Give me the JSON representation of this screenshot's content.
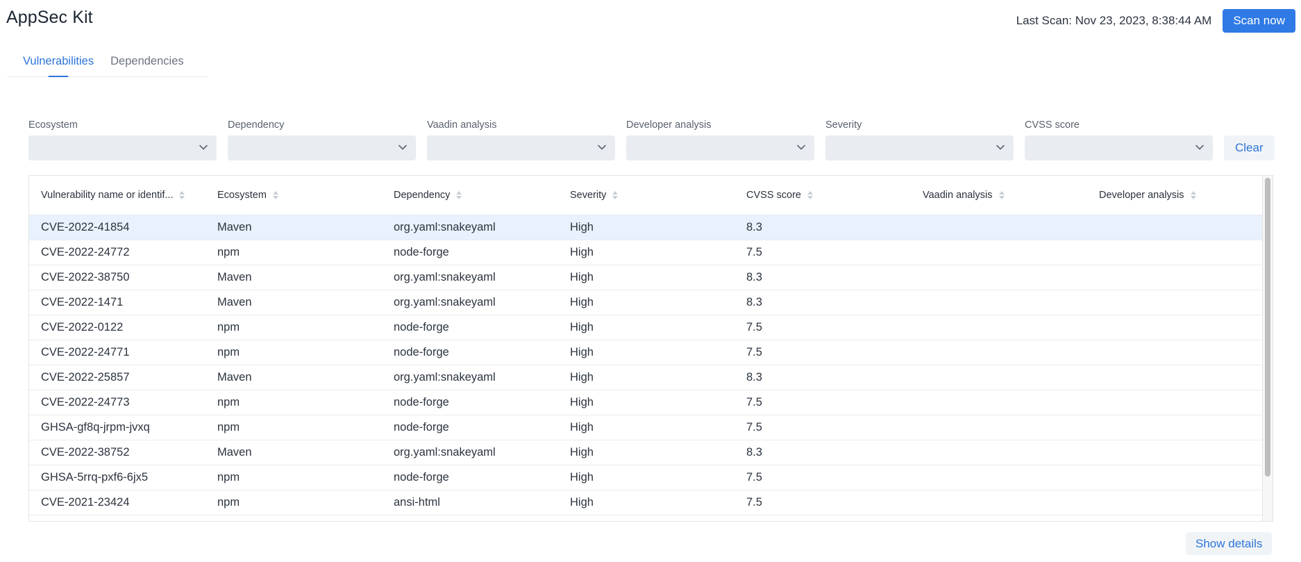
{
  "app": {
    "title": "AppSec Kit"
  },
  "header": {
    "last_scan": "Last Scan: Nov 23, 2023, 8:38:44 AM",
    "scan_now_label": "Scan now",
    "accent_color": "#2f7ae5"
  },
  "tabs": [
    {
      "label": "Vulnerabilities",
      "active": true
    },
    {
      "label": "Dependencies",
      "active": false
    }
  ],
  "filters": [
    {
      "label": "Ecosystem",
      "value": ""
    },
    {
      "label": "Dependency",
      "value": ""
    },
    {
      "label": "Vaadin analysis",
      "value": ""
    },
    {
      "label": "Developer analysis",
      "value": ""
    },
    {
      "label": "Severity",
      "value": ""
    },
    {
      "label": "CVSS score",
      "value": ""
    }
  ],
  "clear_label": "Clear",
  "grid": {
    "columns": [
      "Vulnerability name or identif...",
      "Ecosystem",
      "Dependency",
      "Severity",
      "CVSS score",
      "Vaadin analysis",
      "Developer analysis"
    ],
    "rows": [
      {
        "id": "CVE-2022-41854",
        "ecosystem": "Maven",
        "dependency": "org.yaml:snakeyaml",
        "severity": "High",
        "cvss": "8.3",
        "vaadin": "",
        "developer": "",
        "selected": true
      },
      {
        "id": "CVE-2022-24772",
        "ecosystem": "npm",
        "dependency": "node-forge",
        "severity": "High",
        "cvss": "7.5",
        "vaadin": "",
        "developer": ""
      },
      {
        "id": "CVE-2022-38750",
        "ecosystem": "Maven",
        "dependency": "org.yaml:snakeyaml",
        "severity": "High",
        "cvss": "8.3",
        "vaadin": "",
        "developer": ""
      },
      {
        "id": "CVE-2022-1471",
        "ecosystem": "Maven",
        "dependency": "org.yaml:snakeyaml",
        "severity": "High",
        "cvss": "8.3",
        "vaadin": "",
        "developer": ""
      },
      {
        "id": "CVE-2022-0122",
        "ecosystem": "npm",
        "dependency": "node-forge",
        "severity": "High",
        "cvss": "7.5",
        "vaadin": "",
        "developer": ""
      },
      {
        "id": "CVE-2022-24771",
        "ecosystem": "npm",
        "dependency": "node-forge",
        "severity": "High",
        "cvss": "7.5",
        "vaadin": "",
        "developer": ""
      },
      {
        "id": "CVE-2022-25857",
        "ecosystem": "Maven",
        "dependency": "org.yaml:snakeyaml",
        "severity": "High",
        "cvss": "8.3",
        "vaadin": "",
        "developer": ""
      },
      {
        "id": "CVE-2022-24773",
        "ecosystem": "npm",
        "dependency": "node-forge",
        "severity": "High",
        "cvss": "7.5",
        "vaadin": "",
        "developer": ""
      },
      {
        "id": "GHSA-gf8q-jrpm-jvxq",
        "ecosystem": "npm",
        "dependency": "node-forge",
        "severity": "High",
        "cvss": "7.5",
        "vaadin": "",
        "developer": ""
      },
      {
        "id": "CVE-2022-38752",
        "ecosystem": "Maven",
        "dependency": "org.yaml:snakeyaml",
        "severity": "High",
        "cvss": "8.3",
        "vaadin": "",
        "developer": ""
      },
      {
        "id": "GHSA-5rrq-pxf6-6jx5",
        "ecosystem": "npm",
        "dependency": "node-forge",
        "severity": "High",
        "cvss": "7.5",
        "vaadin": "",
        "developer": ""
      },
      {
        "id": "CVE-2021-23424",
        "ecosystem": "npm",
        "dependency": "ansi-html",
        "severity": "High",
        "cvss": "7.5",
        "vaadin": "",
        "developer": ""
      }
    ]
  },
  "show_details_label": "Show details"
}
